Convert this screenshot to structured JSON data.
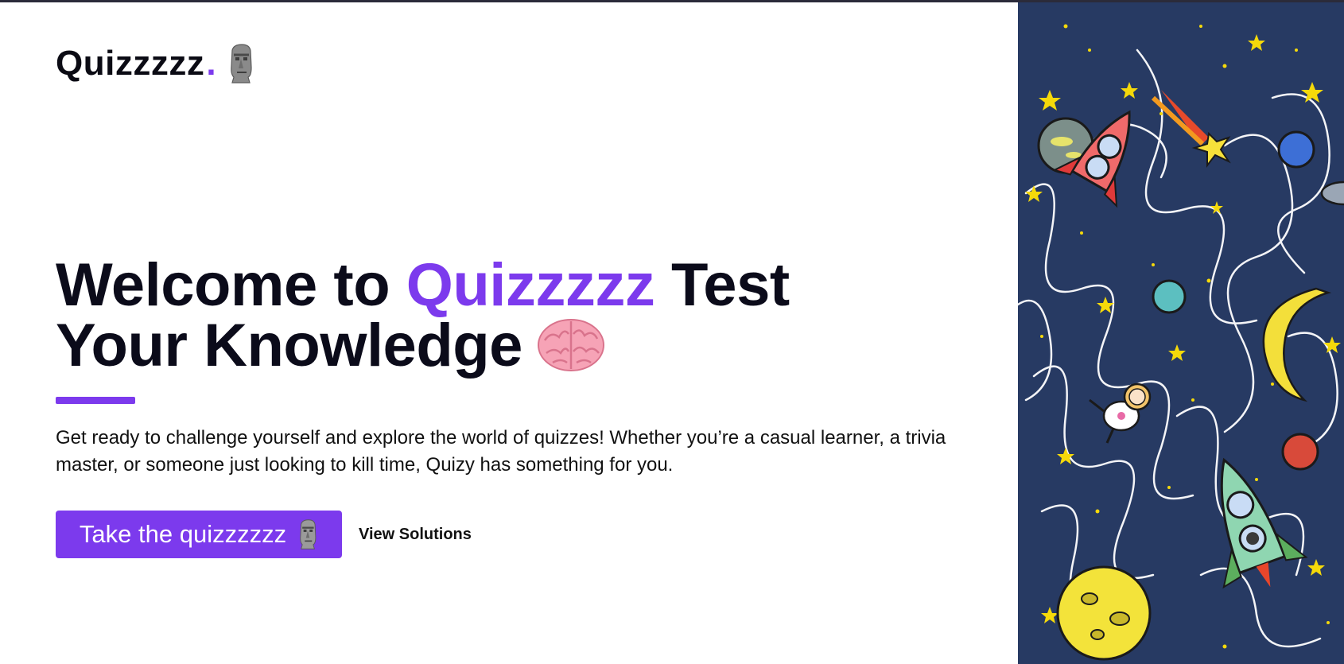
{
  "brand": {
    "name": "Quizzzzz",
    "dot": ".",
    "icon": "moai-icon",
    "accent_color": "#7c3aed"
  },
  "hero": {
    "title_part1": "Welcome to ",
    "title_accent": "Quizzzzz",
    "title_part2": " Test",
    "title_line2": "Your Knowledge",
    "title_icon": "brain-icon",
    "description": "Get ready to challenge yourself and explore the world of quizzes! Whether you’re a casual learner, a trivia master, or someone just looking to kill time, Quizy has something for you."
  },
  "actions": {
    "primary_label": "Take the quizzzzzz",
    "primary_icon": "moai-icon",
    "secondary_label": "View Solutions"
  },
  "illustration": {
    "icon": "space-illustration",
    "background_color": "#273a63"
  }
}
